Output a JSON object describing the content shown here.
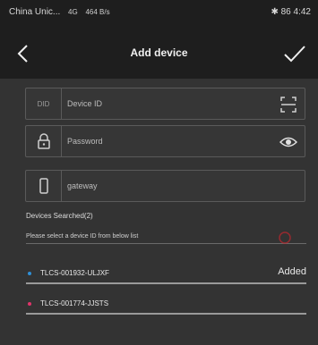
{
  "status_bar": {
    "carrier": "China Unic...",
    "signal_label": "4G",
    "speed_label": "464 B/s",
    "battery": "86",
    "time": "4:42"
  },
  "nav": {
    "title": "Add device"
  },
  "fields": {
    "device_id": {
      "lead_label": "DID",
      "placeholder": "Device ID"
    },
    "password": {
      "placeholder": "Password"
    },
    "gateway": {
      "value": "gateway"
    }
  },
  "devices_section": {
    "title": "Devices Searched(2)",
    "hint": "Please select a device ID from below list",
    "devices": [
      {
        "id": "TLCS-001932-ULJXF",
        "status": "Added",
        "dot_color": "#2f8fd6"
      },
      {
        "id": "TLCS-001774-JJSTS",
        "status": "",
        "dot_color": "#e0346a"
      }
    ]
  },
  "colors": {
    "background": "#333333",
    "bar": "#1e1e1e",
    "accent_red": "#c0272d"
  }
}
